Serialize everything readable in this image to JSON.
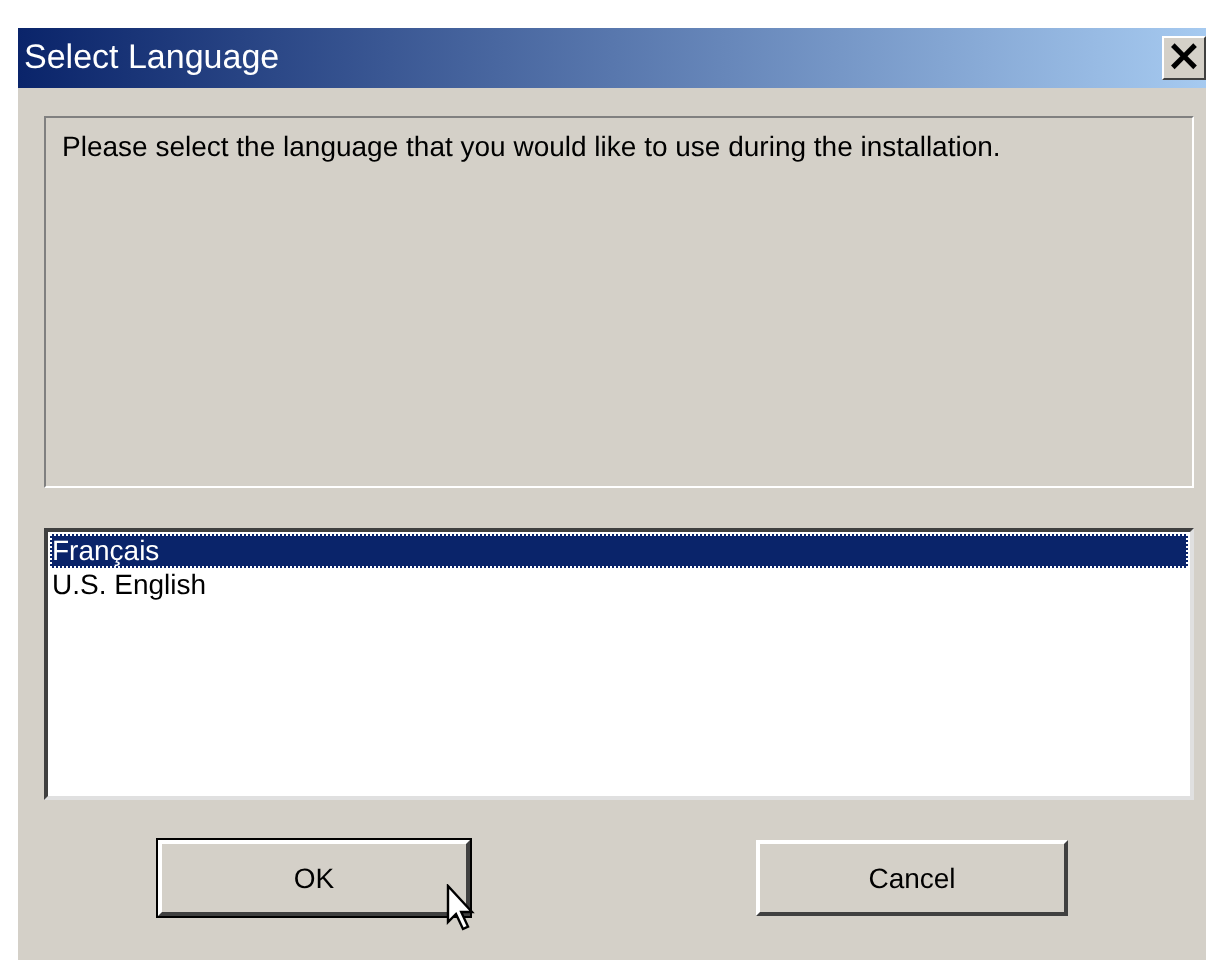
{
  "window": {
    "title": "Select Language",
    "close": "×"
  },
  "message": "Please select the language that you would like to use during the installation.",
  "languages": [
    {
      "label": "Français",
      "selected": true
    },
    {
      "label": "U.S. English",
      "selected": false
    }
  ],
  "buttons": [
    {
      "label": "OK",
      "default": true
    },
    {
      "label": "Cancel",
      "default": false
    }
  ]
}
